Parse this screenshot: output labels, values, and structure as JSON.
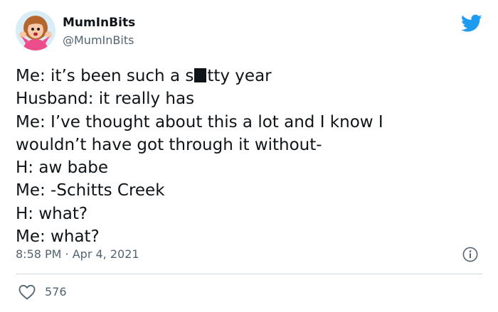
{
  "author": {
    "display_name": "MumInBits",
    "handle": "@MumInBits",
    "avatar_icon": "cartoon-woman-avatar-icon"
  },
  "brand": {
    "logo_icon": "twitter-bird-icon",
    "accent_color": "#1d9bf0"
  },
  "tweet": {
    "line1_before": "Me: it’s been such a s",
    "line1_after": "tty year",
    "line2": "Husband: it really has",
    "line3": "Me: I’ve thought about this a lot and I know I",
    "line4": "wouldn’t have got through it without-",
    "line5": "H: aw babe",
    "line6": "Me: -Schitts Creek",
    "line7": "H: what?",
    "line8": "Me: what?"
  },
  "meta": {
    "timestamp": "8:58 PM · Apr 4, 2021",
    "info_icon": "info-icon"
  },
  "engagement": {
    "like_icon": "heart-icon",
    "like_count": "576"
  }
}
